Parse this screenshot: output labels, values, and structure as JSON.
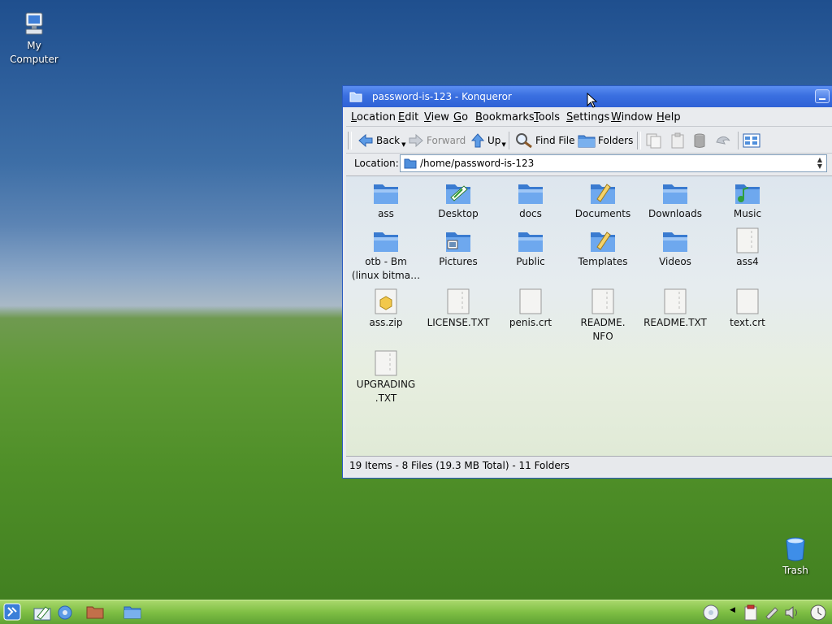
{
  "desktop": {
    "my_computer_label": "My\nComputer",
    "my_computer_line1": "My",
    "my_computer_line2": "Computer",
    "trash_label": "Trash"
  },
  "window": {
    "title": "password-is-123 - Konqueror",
    "menus": [
      {
        "label": "Location",
        "key": "L",
        "rest": "ocation"
      },
      {
        "label": "Edit",
        "key": "E",
        "rest": "dit"
      },
      {
        "label": "View",
        "key": "V",
        "rest": "iew"
      },
      {
        "label": "Go",
        "key": "G",
        "rest": "o"
      },
      {
        "label": "Bookmarks",
        "key": "B",
        "rest": "ookmarks"
      },
      {
        "label": "Tools",
        "key": "T",
        "rest": "ools"
      },
      {
        "label": "Settings",
        "key": "S",
        "rest": "ettings"
      },
      {
        "label": "Window",
        "key": "W",
        "rest": "indow"
      },
      {
        "label": "Help",
        "key": "H",
        "rest": "elp"
      }
    ],
    "toolbar": {
      "back": "Back",
      "forward": "Forward",
      "up": "Up",
      "find_file": "Find File",
      "folders": "Folders"
    },
    "location_label": "Location:",
    "location_path": "/home/password-is-123",
    "files": [
      {
        "name": "ass",
        "line2": "",
        "type": "folder"
      },
      {
        "name": "Desktop",
        "line2": "",
        "type": "desktop"
      },
      {
        "name": "docs",
        "line2": "",
        "type": "folder"
      },
      {
        "name": "Documents",
        "line2": "",
        "type": "documents"
      },
      {
        "name": "Downloads",
        "line2": "",
        "type": "folder"
      },
      {
        "name": "Music",
        "line2": "",
        "type": "music"
      },
      {
        "name": "otb - Bm",
        "line2": "(linux bitma…",
        "type": "folder"
      },
      {
        "name": "Pictures",
        "line2": "",
        "type": "pictures"
      },
      {
        "name": "Public",
        "line2": "",
        "type": "folder"
      },
      {
        "name": "Templates",
        "line2": "",
        "type": "templates"
      },
      {
        "name": "Videos",
        "line2": "",
        "type": "folder"
      },
      {
        "name": "ass4",
        "line2": "",
        "type": "text"
      },
      {
        "name": "ass.zip",
        "line2": "",
        "type": "zip"
      },
      {
        "name": "LICENSE.TXT",
        "line2": "",
        "type": "text"
      },
      {
        "name": "penis.crt",
        "line2": "",
        "type": "blank"
      },
      {
        "name": "README.",
        "line2": "NFO",
        "type": "text"
      },
      {
        "name": "README.TXT",
        "line2": "",
        "type": "text"
      },
      {
        "name": "text.crt",
        "line2": "",
        "type": "blank"
      },
      {
        "name": "UPGRADING",
        "line2": ".TXT",
        "type": "text"
      }
    ],
    "status": "19 Items - 8 Files (19.3 MB Total) - 11 Folders"
  },
  "colors": {
    "titlebar": "#2f62d6",
    "folder": "#4f8fdc",
    "taskbar": "#7fbf44"
  }
}
